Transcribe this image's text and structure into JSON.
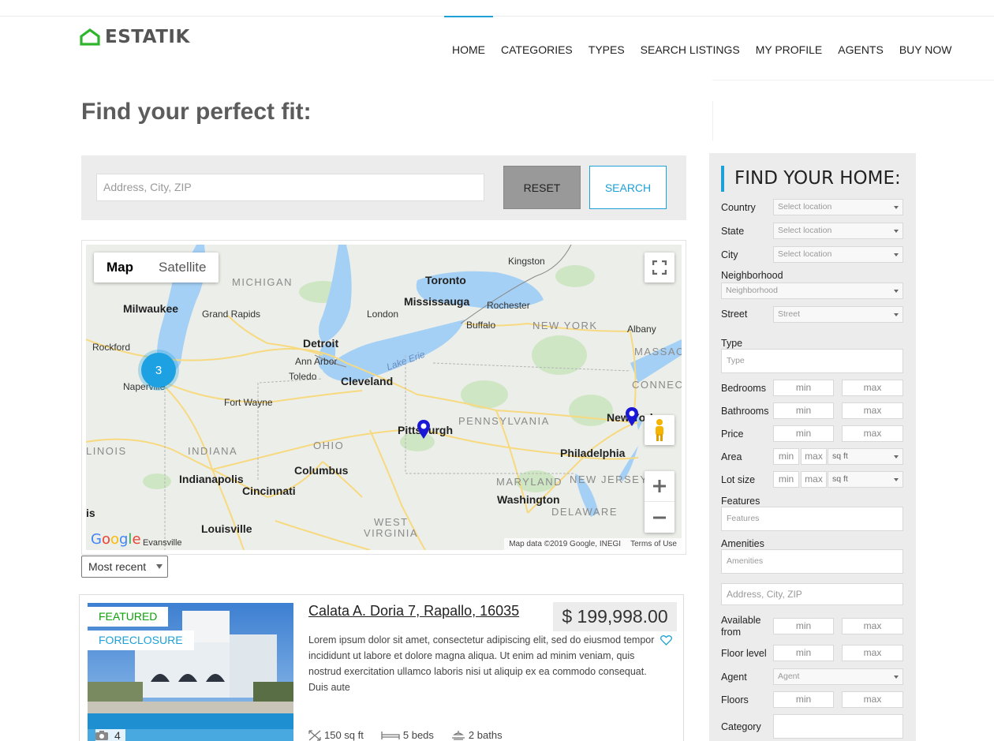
{
  "header": {
    "logo_text": "ESTATIK",
    "nav": [
      {
        "label": "HOME",
        "active": true
      },
      {
        "label": "CATEGORIES"
      },
      {
        "label": "TYPES"
      },
      {
        "label": "SEARCH LISTINGS"
      },
      {
        "label": "MY PROFILE"
      },
      {
        "label": "AGENTS"
      },
      {
        "label": "BUY NOW"
      }
    ]
  },
  "page_title": "Find your perfect fit:",
  "search": {
    "placeholder": "Address, City, ZIP",
    "reset_label": "RESET",
    "search_label": "SEARCH"
  },
  "map": {
    "type_map": "Map",
    "type_satellite": "Satellite",
    "cluster_count": "3",
    "attribution": "Map data ©2019 Google, INEGI",
    "terms": "Terms of Use",
    "google": "Google",
    "labels": {
      "michigan": "MICHIGAN",
      "toronto": "Toronto",
      "kingston": "Kingston",
      "mississauga": "Mississauga",
      "rochester": "Rochester",
      "milwaukee": "Milwaukee",
      "grand_rapids": "Grand Rapids",
      "london": "London",
      "buffalo": "Buffalo",
      "new_york_state": "NEW YORK",
      "albany": "Albany",
      "rockford": "Rockford",
      "detroit": "Detroit",
      "ann_arbor": "Ann Arbor",
      "lake_erie": "Lake Erie",
      "massac": "MASSAC",
      "naperville": "Naperville",
      "toledo": "Toledo",
      "cleveland": "Cleveland",
      "connect": "CONNECT",
      "fort_wayne": "Fort Wayne",
      "pennsylvania": "PENNSYLVANIA",
      "pittsburgh": "Pittsburgh",
      "new_york": "New York",
      "illinois": "LINOIS",
      "indiana": "INDIANA",
      "ohio": "OHIO",
      "columbus": "Columbus",
      "philadelphia": "Philadelphia",
      "indianapolis": "Indianapolis",
      "maryland": "MARYLAND",
      "new_jersey": "NEW JERSEY",
      "cincinnati": "Cincinnati",
      "washington": "Washington",
      "is": "is",
      "delaware": "DELAWARE",
      "louisville": "Louisville",
      "west": "WEST",
      "virginia": "VIRGINIA",
      "evansville": "Evansville"
    }
  },
  "sort": {
    "selected": "Most recent"
  },
  "listing": {
    "badge_featured": "FEATURED",
    "badge_foreclosure": "FORECLOSURE",
    "photo_count": "4",
    "title": "Calata A. Doria 7, Rapallo, 16035",
    "price": "$ 199,998.00",
    "description": "Lorem ipsum dolor sit amet, consectetur adipiscing elit, sed do eiusmod tempor incididunt ut labore et dolore magna aliqua. Ut enim ad minim veniam, quis nostrud exercitation ullamco laboris nisi ut aliquip ex ea commodo consequat. Duis aute",
    "area": "150 sq ft",
    "beds": "5 beds",
    "baths": "2 baths"
  },
  "sidebar": {
    "title": "FIND YOUR HOME:",
    "country_label": "Country",
    "country_value": "Select location",
    "state_label": "State",
    "state_value": "Select location",
    "city_label": "City",
    "city_value": "Select location",
    "neighborhood_label": "Neighborhood",
    "neighborhood_value": "Neighborhood",
    "street_label": "Street",
    "street_value": "Street",
    "type_label": "Type",
    "type_placeholder": "Type",
    "bedrooms_label": "Bedrooms",
    "bathrooms_label": "Bathrooms",
    "price_label": "Price",
    "area_label": "Area",
    "lot_label": "Lot size",
    "unit_value": "sq ft",
    "features_label": "Features",
    "features_placeholder": "Features",
    "amenities_label": "Amenities",
    "amenities_placeholder": "Amenities",
    "address_placeholder": "Address, City, ZIP",
    "available_label_1": "Available",
    "available_label_2": "from",
    "floor_level_label": "Floor level",
    "agent_label": "Agent",
    "agent_value": "Agent",
    "floors_label": "Floors",
    "category_label": "Category",
    "min": "min",
    "max": "max"
  },
  "colors": {
    "accent": "#1da1d8",
    "featured": "#0ea30a",
    "logo_green": "#2fb52b",
    "cluster": "#1da1e2",
    "pin": "#1a17d6"
  }
}
